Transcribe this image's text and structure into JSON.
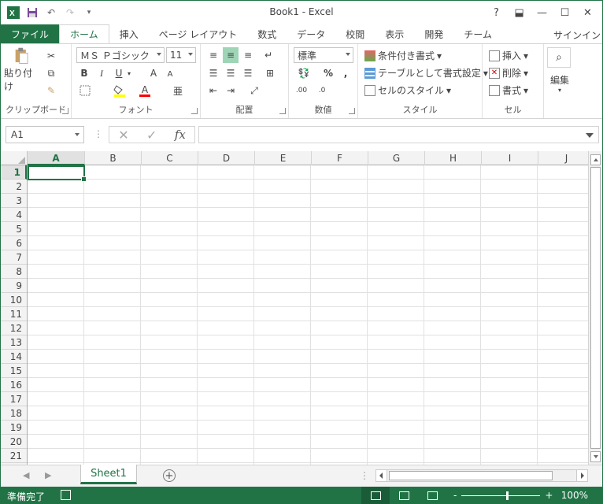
{
  "window": {
    "title": "Book1 - Excel"
  },
  "quick_access": {
    "icons": [
      "excel-logo-icon",
      "save-icon",
      "undo-icon",
      "redo-icon",
      "customize-icon"
    ]
  },
  "window_controls": {
    "help": "?",
    "ribbon_display": "⬓",
    "minimize": "—",
    "maximize": "☐",
    "close": "✕"
  },
  "tabs": [
    {
      "label": "ファイル"
    },
    {
      "label": "ホーム"
    },
    {
      "label": "挿入"
    },
    {
      "label": "ページ レイアウト"
    },
    {
      "label": "数式"
    },
    {
      "label": "データ"
    },
    {
      "label": "校閲"
    },
    {
      "label": "表示"
    },
    {
      "label": "開発"
    },
    {
      "label": "チーム"
    }
  ],
  "signin": "サインイン",
  "ribbon": {
    "clipboard": {
      "label": "クリップボード",
      "paste": "貼り付け"
    },
    "font": {
      "label": "フォント",
      "font_name": "ＭＳ Ｐゴシック",
      "font_size": "11",
      "bold": "B",
      "italic": "I",
      "underline": "U",
      "grow": "A",
      "shrink": "A",
      "color_a": "A"
    },
    "alignment": {
      "label": "配置"
    },
    "number": {
      "label": "数値",
      "format": "標準",
      "percent": "%",
      "comma": ","
    },
    "styles": {
      "label": "スタイル",
      "conditional": "条件付き書式",
      "table": "テーブルとして書式設定",
      "cell_styles": "セルのスタイル"
    },
    "cells": {
      "label": "セル",
      "insert": "挿入",
      "delete": "削除",
      "format": "書式"
    },
    "editing": {
      "label": "編集"
    }
  },
  "formula_bar": {
    "name_box": "A1",
    "fx": "fx",
    "value": ""
  },
  "grid": {
    "columns": [
      "A",
      "B",
      "C",
      "D",
      "E",
      "F",
      "G",
      "H",
      "I",
      "J"
    ],
    "rows": [
      "1",
      "2",
      "3",
      "4",
      "5",
      "6",
      "7",
      "8",
      "9",
      "10",
      "11",
      "12",
      "13",
      "14",
      "15",
      "16",
      "17",
      "18",
      "19",
      "20",
      "21"
    ],
    "selected_cell": "A1"
  },
  "sheets": {
    "tabs": [
      {
        "label": "Sheet1"
      }
    ],
    "add": "+"
  },
  "status": {
    "text": "準備完了",
    "zoom": "100%",
    "minus": "-",
    "plus": "+"
  },
  "colors": {
    "accent": "#217346"
  }
}
